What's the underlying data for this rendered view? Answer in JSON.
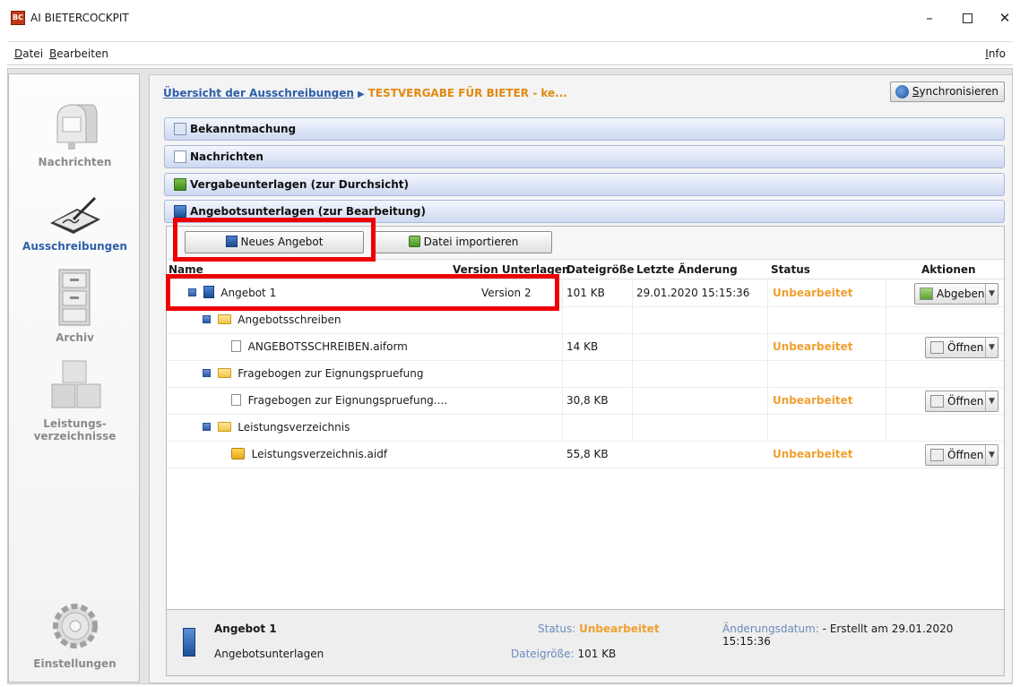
{
  "window": {
    "title": "AI BIETERCOCKPIT",
    "minimize": "–",
    "close": "✕"
  },
  "menu": {
    "datei": "Datei",
    "bearbeiten": "Bearbeiten",
    "info": "Info"
  },
  "sidebar": {
    "items": [
      {
        "label": "Nachrichten",
        "icon": "mailbox-icon",
        "active": false
      },
      {
        "label": "Ausschreibungen",
        "icon": "signature-pad-icon",
        "active": true
      },
      {
        "label": "Archiv",
        "icon": "file-cabinet-icon",
        "active": false
      },
      {
        "label": "Leistungs-verzeichnisse",
        "label_line1": "Leistungs-",
        "label_line2": "verzeichnisse",
        "icon": "boxes-icon",
        "active": false
      },
      {
        "label": "Einstellungen",
        "icon": "gear-icon",
        "active": false
      }
    ]
  },
  "breadcrumb": {
    "link": "Übersicht der Ausschreibungen",
    "current": "TESTVERGABE FÜR BIETER - ke..."
  },
  "sync_button": "Synchronisieren",
  "sections": [
    {
      "label": "Bekanntmachung",
      "icon": "notice-icon"
    },
    {
      "label": "Nachrichten",
      "icon": "envelope-icon"
    },
    {
      "label": "Vergabeunterlagen (zur Durchsicht)",
      "icon": "green-book-icon"
    },
    {
      "label": "Angebotsunterlagen (zur Bearbeitung)",
      "icon": "blue-book-icon"
    }
  ],
  "toolbar": {
    "neues_angebot": "Neues Angebot",
    "datei_importieren": "Datei importieren"
  },
  "table": {
    "headers": {
      "name": "Name",
      "version": "Version Unterlagen",
      "size": "Dateigröße",
      "modified": "Letzte Änderung",
      "status": "Status",
      "actions": "Aktionen"
    },
    "rows": [
      {
        "name": "Angebot 1",
        "version": "Version 2",
        "size": "101 KB",
        "modified": "29.01.2020 15:15:36",
        "status": "Unbearbeitet",
        "action": "Abgeben"
      },
      {
        "name": "Angebotsschreiben",
        "version": "",
        "size": "",
        "modified": "",
        "status": "",
        "action": ""
      },
      {
        "name": "ANGEBOTSSCHREIBEN.aiform",
        "version": "",
        "size": "14 KB",
        "modified": "",
        "status": "Unbearbeitet",
        "action": "Öffnen"
      },
      {
        "name": "Fragebogen zur Eignungspruefung",
        "version": "",
        "size": "",
        "modified": "",
        "status": "",
        "action": ""
      },
      {
        "name": "Fragebogen zur Eignungspruefung....",
        "version": "",
        "size": "30,8 KB",
        "modified": "",
        "status": "Unbearbeitet",
        "action": "Öffnen"
      },
      {
        "name": "Leistungsverzeichnis",
        "version": "",
        "size": "",
        "modified": "",
        "status": "",
        "action": ""
      },
      {
        "name": "Leistungsverzeichnis.aidf",
        "version": "",
        "size": "55,8 KB",
        "modified": "",
        "status": "Unbearbeitet",
        "action": "Öffnen"
      }
    ]
  },
  "detail": {
    "title": "Angebot 1",
    "subtitle": "Angebotsunterlagen",
    "status_label": "Status:",
    "status_value": "Unbearbeitet",
    "size_label": "Dateigröße:",
    "size_value": "101 KB",
    "date_label": "Änderungsdatum:",
    "date_value": "- Erstellt am 29.01.2020 15:15:36"
  },
  "colors": {
    "accent_blue": "#2f5fa8",
    "status_orange": "#f0a030",
    "highlight_red": "#ee0000"
  }
}
